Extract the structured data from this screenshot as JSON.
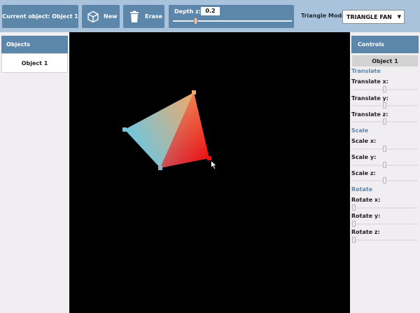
{
  "toolbar": {
    "current_object_label": "Current object: Object 1",
    "new_label": "New",
    "erase_label": "Erase",
    "depth_label": "Depth z:",
    "depth_value": "0.2",
    "triangle_mode_label": "Triangle Mode:",
    "triangle_mode_value": "TRIANGLE FAN",
    "icons": {
      "new": "cube-icon",
      "erase": "trash-icon"
    }
  },
  "objects_panel": {
    "header": "Objects",
    "items": [
      {
        "label": "Object 1"
      }
    ]
  },
  "controls_panel": {
    "header": "Controls",
    "current_object": "Object 1",
    "sections": [
      {
        "title": "Translate",
        "controls": [
          {
            "label": "Translate x:"
          },
          {
            "label": "Translate y:"
          },
          {
            "label": "Translate z:"
          }
        ]
      },
      {
        "title": "Scale",
        "controls": [
          {
            "label": "Scale x:"
          },
          {
            "label": "Scale y:"
          },
          {
            "label": "Scale z:"
          }
        ]
      },
      {
        "title": "Rotate",
        "controls": [
          {
            "label": "Rotate x:"
          },
          {
            "label": "Rotate y:"
          },
          {
            "label": "Rotate z:"
          }
        ]
      }
    ]
  },
  "colors": {
    "panel_accent": "#5c87aa",
    "toolbar_bg": "#a9c3dc",
    "canvas_bg": "#000000",
    "vertex_blue": "#6ec6df",
    "vertex_orange": "#f1a868",
    "vertex_red": "#ee1111"
  }
}
